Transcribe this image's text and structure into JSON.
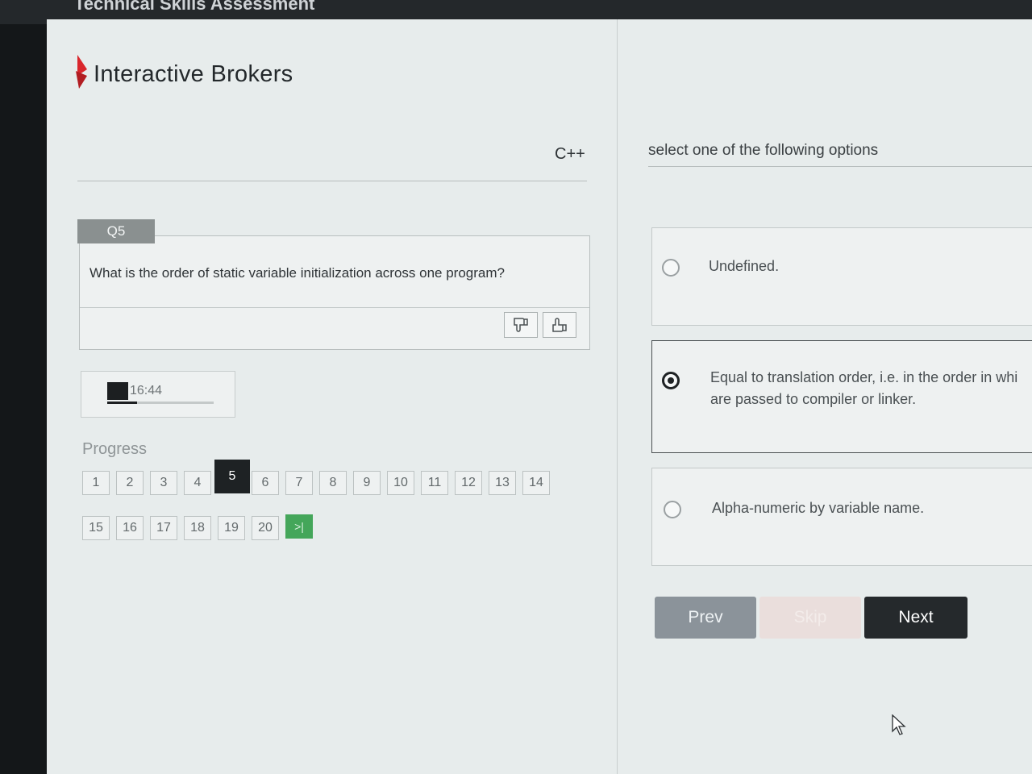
{
  "window": {
    "title": "Technical Skills Assessment"
  },
  "brand": {
    "name": "Interactive Brokers",
    "accent": "#d9262c"
  },
  "header": {
    "language": "C++",
    "instruction": "select one of the following options"
  },
  "question": {
    "tab_label": "Q5",
    "text": "What is the order of static variable initialization across one program?",
    "dislike_icon": "thumbs-down-icon",
    "like_icon": "thumbs-up-icon"
  },
  "timer": {
    "value": "16:44",
    "progress_fraction": 0.28
  },
  "progress": {
    "label": "Progress",
    "current": 5,
    "row1": [
      "1",
      "2",
      "3",
      "4",
      "5",
      "6",
      "7",
      "8",
      "9",
      "10",
      "11",
      "12",
      "13",
      "14"
    ],
    "row2": [
      "15",
      "16",
      "17",
      "18",
      "19",
      "20"
    ],
    "last_button": ">|"
  },
  "options": [
    {
      "label": "Undefined.",
      "selected": false
    },
    {
      "line1": "Equal to translation order, i.e. in the order in whi",
      "line2": "are passed to compiler or linker.",
      "selected": true
    },
    {
      "label": "Alpha-numeric by variable name.",
      "selected": false
    }
  ],
  "buttons": {
    "prev": "Prev",
    "skip": "Skip",
    "next": "Next"
  },
  "colors": {
    "selected": "#1e2224",
    "last_button": "#44a65a",
    "next_button": "#25292c",
    "prev_button": "#8b939a"
  }
}
